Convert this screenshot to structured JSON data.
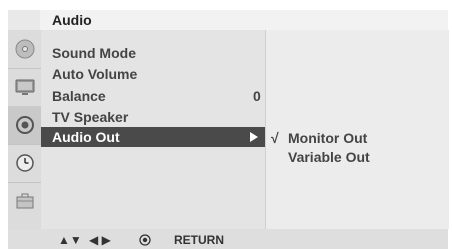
{
  "title": "Audio",
  "sidebar": {
    "icons": [
      "disc-icon",
      "tv-screen-icon",
      "target-icon",
      "clock-icon",
      "suitcase-icon"
    ],
    "active_index": 2
  },
  "menu": {
    "items": [
      {
        "label": "Sound Mode",
        "value": ""
      },
      {
        "label": "Auto Volume",
        "value": ""
      },
      {
        "label": "Balance",
        "value": "0"
      },
      {
        "label": "TV Speaker",
        "value": ""
      },
      {
        "label": "Audio Out",
        "value": ""
      }
    ],
    "selected_label": "Audio Out"
  },
  "submenu": {
    "check_mark": "√",
    "items": [
      "Monitor Out",
      "Variable Out"
    ],
    "checked": "Monitor Out"
  },
  "footer": {
    "nav_updown": "▲▼",
    "nav_leftright": "◀ ▶",
    "return_label": "RETURN"
  }
}
